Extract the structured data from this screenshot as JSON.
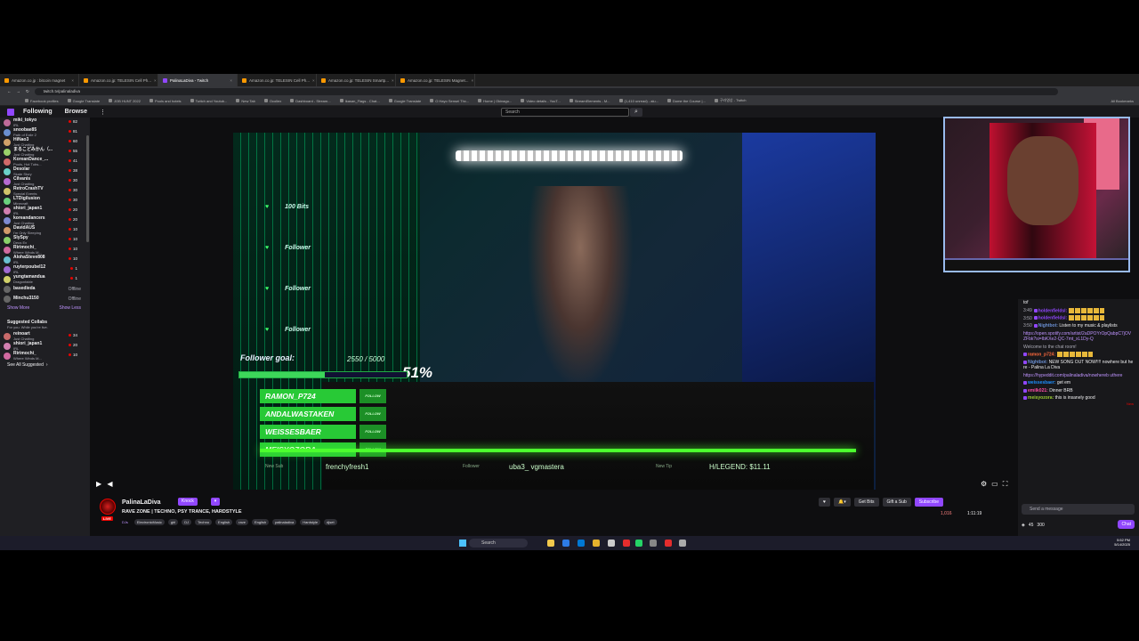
{
  "browser": {
    "tabs": [
      {
        "title": "Amazon.co.jp : bitcoin magnet"
      },
      {
        "title": "Amazon.co.jp: TELESIN Cell Ph..."
      },
      {
        "title": "PalinaLaDiva - Twitch"
      },
      {
        "title": "Amazon.co.jp: TELESIN Cell Ph..."
      },
      {
        "title": "Amazon.co.jp: TELESIN Smartp..."
      },
      {
        "title": "Amazon.co.jp: TELESIN Magnet..."
      }
    ],
    "url": "twitch.tv/palinaladiva",
    "bookmarks": [
      "Facebook profiles",
      "Google Translate",
      "JOB HUNT 2022",
      "Pools and hotels",
      "Twitch and Youtub...",
      "New Tab",
      "Ocollex",
      "Dashboard - Stream...",
      "Ikasan_Flags - Chat...",
      "Google Translate",
      "O Hayo Sensei Thx...",
      "Home | Okinagu...",
      "Video details - YouT...",
      "StreamElements - M...",
      "(1,410 unread) - alu...",
      "Dome the Course |...",
      "구라영상 - Twitch"
    ],
    "all_bookmarks": "All Bookmarks"
  },
  "twitch": {
    "nav": {
      "following": "Following",
      "browse": "Browse",
      "more": "⋮"
    },
    "search_placeholder": "Search",
    "search_icon": "search-icon",
    "sidebar": {
      "channels": [
        {
          "name": "miki_tokyo",
          "game": "IRL",
          "viewers": "82",
          "color": "#c06b9a"
        },
        {
          "name": "snoobae85",
          "game": "Path of Exile 2",
          "viewers": "81",
          "color": "#6a8fd1"
        },
        {
          "name": "HiNao3",
          "game": "Just Chatting",
          "viewers": "60",
          "color": "#d1a16a"
        },
        {
          "name": "まるこどみかん（...",
          "game": "Just Chatting",
          "viewers": "55",
          "color": "#9ad16a"
        },
        {
          "name": "KoreanDance_...",
          "game": "Pools, Hot Tubs...",
          "viewers": "41",
          "color": "#d16a6a"
        },
        {
          "name": "Desolar",
          "game": "Skate Story",
          "viewers": "38",
          "color": "#6ad1c9"
        },
        {
          "name": "Cilvanis",
          "game": "Just Chatting",
          "viewers": "30",
          "color": "#b56ad1"
        },
        {
          "name": "RetroCrashTV",
          "game": "Special Events",
          "viewers": "30",
          "color": "#d1c46a"
        },
        {
          "name": "LTDigilusion",
          "game": "Minecraft",
          "viewers": "30",
          "color": "#6ad17d"
        },
        {
          "name": "shiori_japan1",
          "game": "IRL",
          "viewers": "20",
          "color": "#d17fb0"
        },
        {
          "name": "koreandancers",
          "game": "Just Chatting",
          "viewers": "20",
          "color": "#7d8ad1"
        },
        {
          "name": "DavidAUS",
          "game": "I'm Only Sleeping",
          "viewers": "10",
          "color": "#d19a6a"
        },
        {
          "name": "SlySpy",
          "game": "Deus Ex",
          "viewers": "10",
          "color": "#8ad16a"
        },
        {
          "name": "Ririmochi_",
          "game": "Where Winds M...",
          "viewers": "10",
          "color": "#d16aa0"
        },
        {
          "name": "AlohaSteve808",
          "game": "IRL",
          "viewers": "10",
          "color": "#6abfd1"
        },
        {
          "name": "ruyterpoubel12",
          "game": "IRL",
          "viewers": "1",
          "color": "#a06ad1"
        },
        {
          "name": "yungtamandua",
          "game": "Dragonfable",
          "viewers": "1",
          "color": "#d1d16a"
        }
      ],
      "offline": [
        {
          "name": "basedieda",
          "status": "Offline"
        },
        {
          "name": "Minchu3150",
          "status": "Offline"
        }
      ],
      "show_more": "Show More",
      "show_less": "Show Less",
      "suggested_title": "Suggested Collabs",
      "suggested_sub": "For you. While you're live.",
      "suggested": [
        {
          "name": "reinoart",
          "game": "Just Chatting",
          "viewers": "34",
          "color": "#c96a6a"
        },
        {
          "name": "shiori_japan1",
          "game": "IRL",
          "viewers": "20",
          "color": "#d17fb0"
        },
        {
          "name": "Ririmochi_",
          "game": "Where Winds M...",
          "viewers": "10",
          "color": "#d16aa0"
        }
      ],
      "see_all": "See All Suggested"
    },
    "overlay": {
      "alerts": [
        {
          "text": "100 Bits"
        },
        {
          "text": "Follower"
        },
        {
          "text": "Follower"
        },
        {
          "text": "Follower"
        }
      ],
      "goal_label": "Follower goal:",
      "goal_value": "2550 / 5000",
      "goal_percent": "51%",
      "goal_fraction": 0.51,
      "recent_names": [
        "RAMON_P724",
        "ANDALWASTAKEN",
        "WEISSESBAER",
        "MEISYOZORA"
      ],
      "follow_label": "FOLLOW",
      "ticker": {
        "new_sub_label": "New Sub",
        "new_sub": "frenchyfresh1",
        "follower_label": "Follower",
        "follower": "uba3_  vgmastera",
        "new_tip_label": "New Tip",
        "legend": "H/LEGEND: $11.11"
      }
    },
    "channel": {
      "name": "PalinaLaDiva",
      "live": "LIVE",
      "knock": "Knock",
      "title": "RAVE ZONE | TECHNO, PSY TRANCE, HARDSTYLE",
      "game": "DJs",
      "tags": [
        "ElectronicMusic",
        "girl",
        "DJ",
        "Techno",
        "English",
        "rave",
        "English",
        "palinaladiva",
        "Hardstyle",
        "djset"
      ],
      "get_bits": "Get Bits",
      "gift_sub": "Gift a Sub",
      "subscribe": "Subscribe",
      "viewers": "1,016",
      "uptime": "1:11:19"
    },
    "chat": {
      "messages": [
        {
          "ts": "",
          "user": "",
          "color": "#efeff1",
          "text": "tof",
          "type": "plain"
        },
        {
          "ts": "3:49",
          "user": "holdenfieldsl:",
          "color": "#9147ff",
          "text": "",
          "type": "emote"
        },
        {
          "ts": "3:50",
          "user": "holdenfieldsl:",
          "color": "#9147ff",
          "text": "",
          "type": "emote"
        },
        {
          "ts": "3:50",
          "user": "Nightbot:",
          "color": "#6a8fd1",
          "text": "Listen to my music & playlists",
          "type": "plain"
        },
        {
          "ts": "",
          "user": "",
          "color": "#bf94ff",
          "text": "https://open.spotify.com/artist/2aDPOYrOpQabpC7jOVZFbk?si=IbKXe2-QC-7mt_xL1Dy-Q",
          "type": "link"
        },
        {
          "ts": "",
          "user": "",
          "color": "#adadb8",
          "text": "Welcome to the chat room!",
          "type": "sys"
        },
        {
          "ts": "",
          "user": "ramon_p724:",
          "color": "#ff6a3d",
          "text": "",
          "type": "emote"
        },
        {
          "ts": "",
          "user": "Nightbot:",
          "color": "#6a8fd1",
          "text": "NEW SONG OUT NOW!!!! nowhere but here - Palina La Diva",
          "type": "plain"
        },
        {
          "ts": "",
          "user": "",
          "color": "#bf94ff",
          "text": "https://hypeddit.com/palinaladiva/nowhereb uthere",
          "type": "link"
        },
        {
          "ts": "",
          "user": "weissesbaer:",
          "color": "#1e90ff",
          "text": "get em",
          "type": "plain"
        },
        {
          "ts": "",
          "user": "emilk021:",
          "color": "#ff4da6",
          "text": "Dinner BRB",
          "type": "plain"
        },
        {
          "ts": "",
          "user": "meisyozora:",
          "color": "#9acd32",
          "text": "this is insanely good",
          "type": "plain"
        }
      ],
      "new_label": "New",
      "input_placeholder": "Send a message",
      "points": "45",
      "points2": "300",
      "chat_button": "Chat"
    }
  },
  "taskbar": {
    "search": "Search",
    "time": "5:52 PM",
    "date": "5/14/2025",
    "lang": "ENG"
  }
}
